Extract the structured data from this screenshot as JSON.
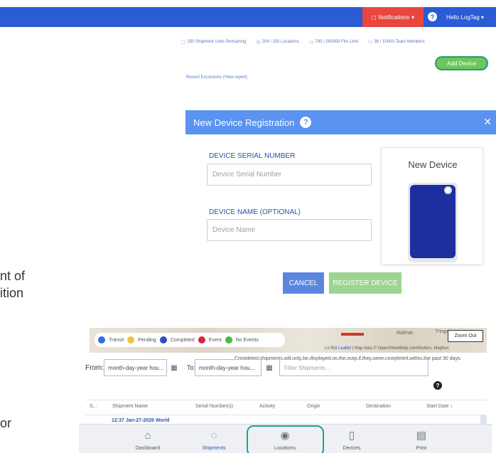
{
  "topbar": {
    "notifications_label": "Notifications",
    "help_glyph": "?",
    "hello_label": "Hello LogTag",
    "bg_color": "#2c5bd6",
    "notification_color": "#e8463e"
  },
  "stats": [
    {
      "icon": "clipboard-icon",
      "text": "250 Shipment Units Remaining"
    },
    {
      "icon": "location-pin-icon",
      "text": "204 / 250 Locations"
    },
    {
      "icon": "file-icon",
      "text": "790 / 250000 File Limit"
    },
    {
      "icon": "users-icon",
      "text": "38 / 10000 Team Members"
    }
  ],
  "add_device_label": "Add Device",
  "recent_excursions": "Recent Excursions (View report)",
  "left_cut_text": [
    "nt of",
    "ition",
    "or"
  ],
  "modal": {
    "title": "New Device Registration",
    "serial_label": "DEVICE SERIAL NUMBER",
    "serial_placeholder": "Device Serial Number",
    "name_label": "DEVICE NAME (OPTIONAL)",
    "name_placeholder": "Device Name",
    "card_title": "New Device",
    "cancel_label": "CANCEL",
    "register_label": "REGISTER DEVICE",
    "header_color": "#5a93f0"
  },
  "map": {
    "legend": [
      {
        "label": "Transit",
        "color": "#2f6fd6"
      },
      {
        "label": "Pending",
        "color": "#f2c233"
      },
      {
        "label": "Completed",
        "color": "#2c4fc7"
      },
      {
        "label": "Event",
        "color": "#d7263d"
      },
      {
        "label": "No Events",
        "color": "#4cb848"
      }
    ],
    "zoom_out_label": "Zoom Out",
    "road_label": "A46",
    "city1": "Malmar",
    "city2": "Tringel",
    "attribution_prefix": "Lo Roi ",
    "attribution_leaflet": "Leaflet",
    "attribution_rest": " | Map data © OpenStreetMap contributors, Mapbox",
    "completed_note": "Completed shipments will only be displayed on the map if they were completed within the past 30 days."
  },
  "filters": {
    "from_label": "From:",
    "from_placeholder": "month-day-year hou...",
    "to_label": "To:",
    "to_placeholder": "month-day-year hou...",
    "filter_placeholder": "Filter Shipments..."
  },
  "table": {
    "columns": [
      "S...",
      "Shipment Name",
      "Serial Number(s)",
      "Activity",
      "Origin",
      "Destination",
      "Start Date"
    ],
    "sort_arrow": "↓",
    "first_row": "12:37 Jan-27-2026 World"
  },
  "bottom_nav": [
    {
      "label": "Dashboard",
      "icon": "home-icon",
      "active": false
    },
    {
      "label": "Shipments",
      "icon": "shipments-icon",
      "active": true
    },
    {
      "label": "Locations",
      "icon": "location-pin-icon",
      "active": false
    },
    {
      "label": "Devices",
      "icon": "device-icon",
      "active": false
    },
    {
      "label": "Print",
      "icon": "print-icon",
      "active": false
    }
  ]
}
